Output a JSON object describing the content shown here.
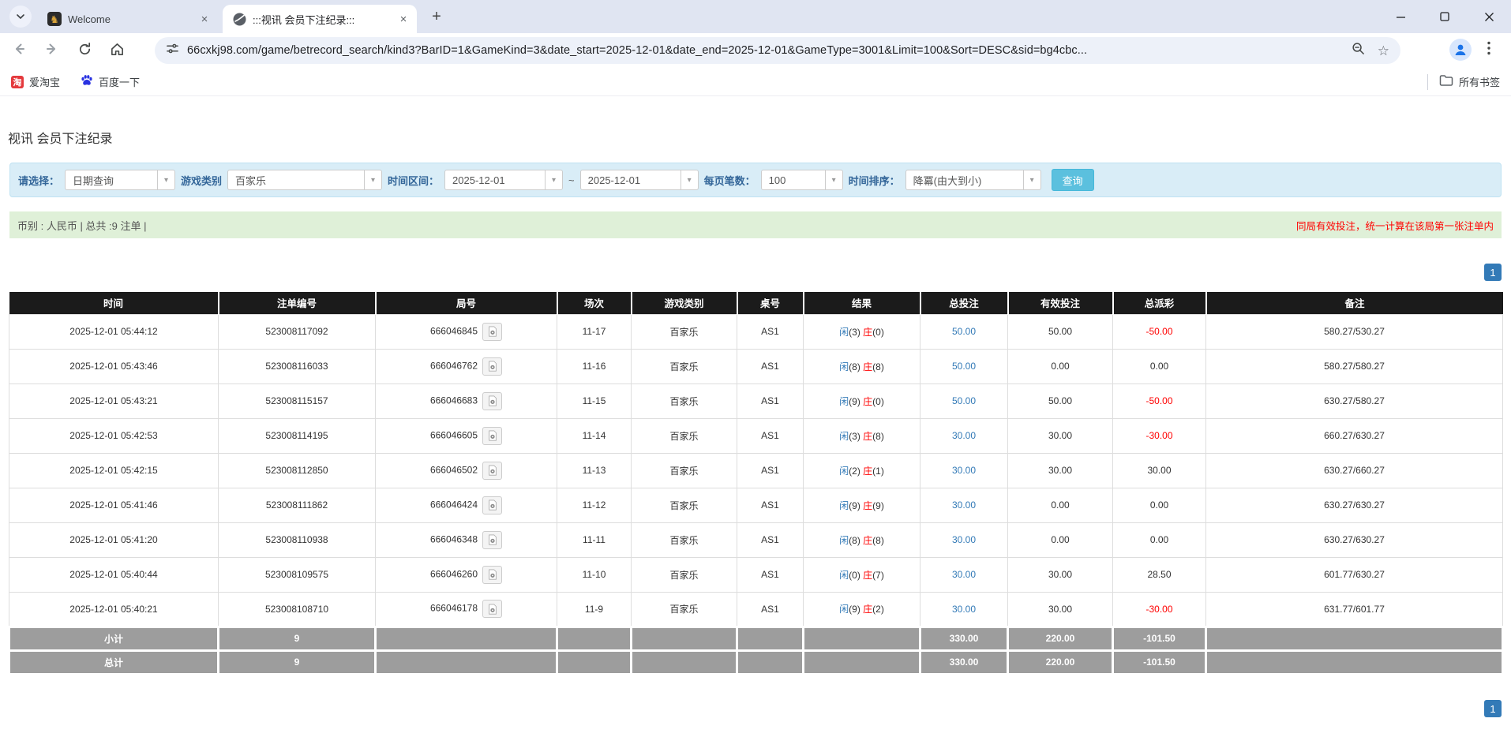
{
  "browser": {
    "tabs": [
      {
        "title": "Welcome"
      },
      {
        "title": ":::视讯 会员下注纪录:::"
      }
    ],
    "url": "66cxkj98.com/game/betrecord_search/kind3?BarID=1&GameKind=3&date_start=2025-12-01&date_end=2025-12-01&GameType=3001&Limit=100&Sort=DESC&sid=bg4cbc...",
    "bookmarks": [
      {
        "label": "爱淘宝",
        "icon": "taobao-icon",
        "icon_glyph": "淘"
      },
      {
        "label": "百度一下",
        "icon": "baidu-paw-icon"
      }
    ],
    "all_bookmarks_label": "所有书签"
  },
  "page": {
    "title": "视讯 会员下注纪录",
    "filter": {
      "select_label": "请选择：",
      "select_value": "日期查询",
      "game_type_label": "游戏类别",
      "game_type_value": "百家乐",
      "date_label": "时间区间：",
      "date_start": "2025-12-01",
      "range_separator": "~",
      "date_end": "2025-12-01",
      "page_size_label": "每页笔数：",
      "page_size_value": "100",
      "sort_label": "时间排序：",
      "sort_value": "降冪(由大到小)",
      "search_button_label": "查询"
    },
    "summary": {
      "left": "币别 : 人民币 | 总共 :9 注单 |",
      "right": "同局有效投注，统一计算在该局第一张注单内"
    },
    "pagination_label": "1",
    "table": {
      "headers": [
        "时间",
        "注单编号",
        "局号",
        "场次",
        "游戏类别",
        "桌号",
        "结果",
        "总投注",
        "有效投注",
        "总派彩",
        "备注"
      ],
      "player_label": "闲",
      "banker_label": "庄",
      "rows": [
        {
          "time": "2025-12-01 05:44:12",
          "bet_no": "523008117092",
          "round_no": "666046845",
          "session": "11-17",
          "game": "百家乐",
          "table_no": "AS1",
          "player": "3",
          "banker": "0",
          "total_bet": "50.00",
          "valid_bet": "50.00",
          "payout": "-50.00",
          "remark": "580.27/530.27"
        },
        {
          "time": "2025-12-01 05:43:46",
          "bet_no": "523008116033",
          "round_no": "666046762",
          "session": "11-16",
          "game": "百家乐",
          "table_no": "AS1",
          "player": "8",
          "banker": "8",
          "total_bet": "50.00",
          "valid_bet": "0.00",
          "payout": "0.00",
          "remark": "580.27/580.27"
        },
        {
          "time": "2025-12-01 05:43:21",
          "bet_no": "523008115157",
          "round_no": "666046683",
          "session": "11-15",
          "game": "百家乐",
          "table_no": "AS1",
          "player": "9",
          "banker": "0",
          "total_bet": "50.00",
          "valid_bet": "50.00",
          "payout": "-50.00",
          "remark": "630.27/580.27"
        },
        {
          "time": "2025-12-01 05:42:53",
          "bet_no": "523008114195",
          "round_no": "666046605",
          "session": "11-14",
          "game": "百家乐",
          "table_no": "AS1",
          "player": "3",
          "banker": "8",
          "total_bet": "30.00",
          "valid_bet": "30.00",
          "payout": "-30.00",
          "remark": "660.27/630.27"
        },
        {
          "time": "2025-12-01 05:42:15",
          "bet_no": "523008112850",
          "round_no": "666046502",
          "session": "11-13",
          "game": "百家乐",
          "table_no": "AS1",
          "player": "2",
          "banker": "1",
          "total_bet": "30.00",
          "valid_bet": "30.00",
          "payout": "30.00",
          "remark": "630.27/660.27"
        },
        {
          "time": "2025-12-01 05:41:46",
          "bet_no": "523008111862",
          "round_no": "666046424",
          "session": "11-12",
          "game": "百家乐",
          "table_no": "AS1",
          "player": "9",
          "banker": "9",
          "total_bet": "30.00",
          "valid_bet": "0.00",
          "payout": "0.00",
          "remark": "630.27/630.27"
        },
        {
          "time": "2025-12-01 05:41:20",
          "bet_no": "523008110938",
          "round_no": "666046348",
          "session": "11-11",
          "game": "百家乐",
          "table_no": "AS1",
          "player": "8",
          "banker": "8",
          "total_bet": "30.00",
          "valid_bet": "0.00",
          "payout": "0.00",
          "remark": "630.27/630.27"
        },
        {
          "time": "2025-12-01 05:40:44",
          "bet_no": "523008109575",
          "round_no": "666046260",
          "session": "11-10",
          "game": "百家乐",
          "table_no": "AS1",
          "player": "0",
          "banker": "7",
          "total_bet": "30.00",
          "valid_bet": "30.00",
          "payout": "28.50",
          "remark": "601.77/630.27"
        },
        {
          "time": "2025-12-01 05:40:21",
          "bet_no": "523008108710",
          "round_no": "666046178",
          "session": "11-9",
          "game": "百家乐",
          "table_no": "AS1",
          "player": "9",
          "banker": "2",
          "total_bet": "30.00",
          "valid_bet": "30.00",
          "payout": "-30.00",
          "remark": "631.77/601.77"
        }
      ],
      "subtotal": {
        "label": "小计",
        "count": "9",
        "total_bet": "330.00",
        "valid_bet": "220.00",
        "payout": "-101.50"
      },
      "total": {
        "label": "总计",
        "count": "9",
        "total_bet": "330.00",
        "valid_bet": "220.00",
        "payout": "-101.50"
      }
    },
    "colors": {
      "accent_blue": "#337ab7",
      "negative_red": "#ff0000",
      "filter_bg": "#d9edf7",
      "summary_bg": "#dff0d8",
      "table_header_bg": "#1b1b1b",
      "subtotal_bg": "#9d9d9d",
      "search_button_bg": "#5bc0de"
    }
  }
}
